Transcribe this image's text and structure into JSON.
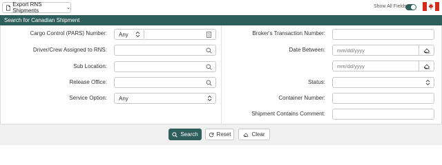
{
  "toolbar": {
    "export_label": "Export RNS Shipments",
    "show_all_label": "Show All Fields",
    "show_all_on": true
  },
  "header": {
    "title": "Search for Canadian Shipment"
  },
  "left": {
    "cargo_label": "Cargo Control (PARS) Number:",
    "cargo_select": "Any",
    "driver_label": "Driver/Crew Assigned to RNS:",
    "sublocation_label": "Sub Location:",
    "release_label": "Release Office:",
    "service_label": "Service Option:",
    "service_select": "Any"
  },
  "right": {
    "broker_label": "Broker's Transaction Number:",
    "date_label": "Date Between:",
    "date_from_placeholder": "mm/dd/yyyy",
    "date_to_placeholder": "mm/dd/yyyy",
    "status_label": "Status:",
    "container_label": "Container Number:",
    "comment_label": "Shipment Contains Comment:"
  },
  "footer": {
    "search_label": "Search",
    "reset_label": "Reset",
    "clear_label": "Clear"
  },
  "colors": {
    "accent": "#2e5f5c",
    "flag_red": "#d52b1e"
  }
}
